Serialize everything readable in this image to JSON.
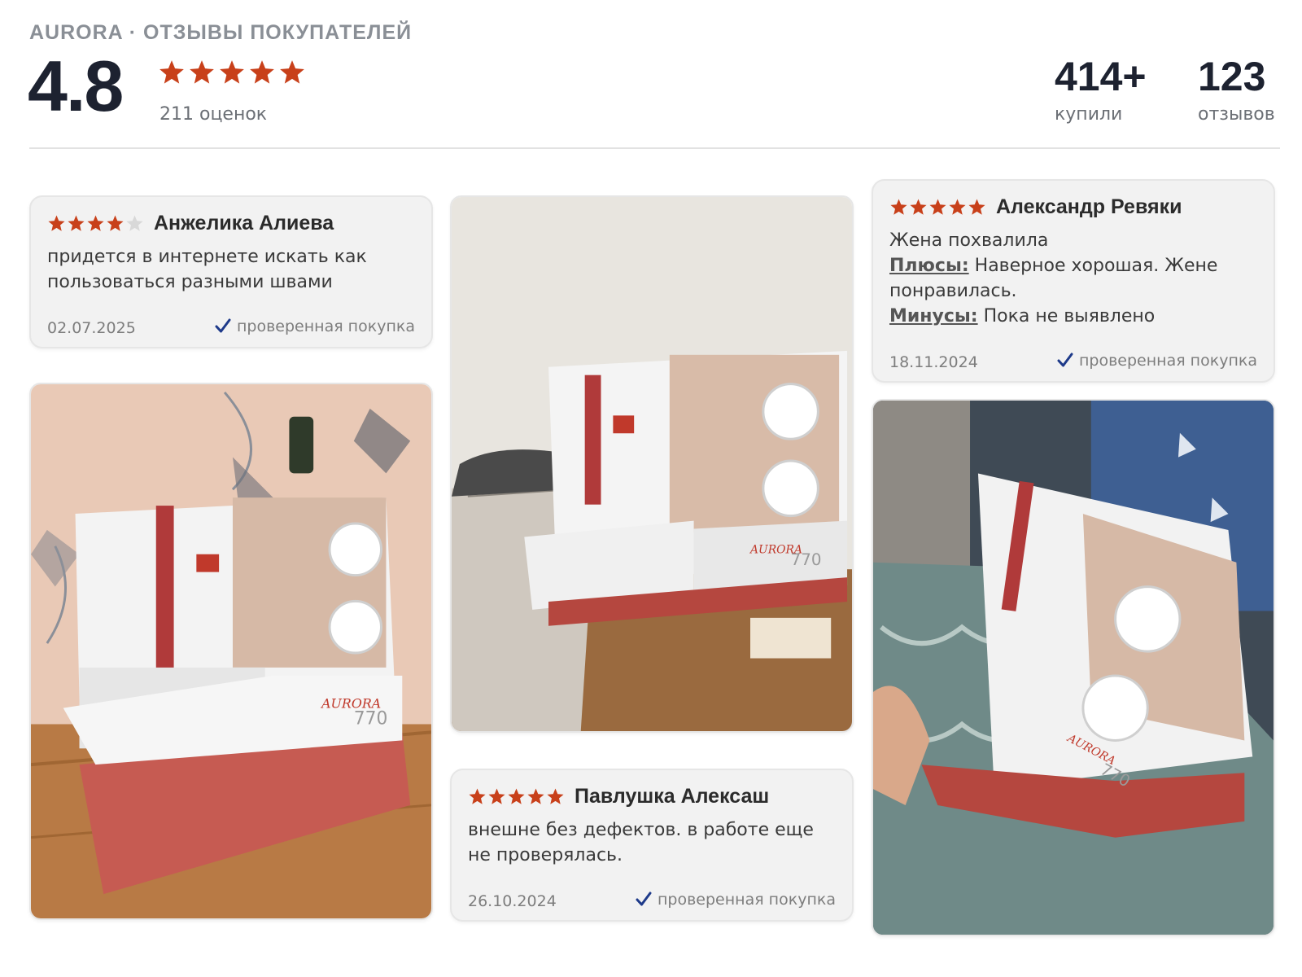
{
  "header": {
    "brand_line": "AURORA · ОТЗЫВЫ ПОКУПАТЕЛЕЙ",
    "rating": "4.8",
    "rating_stars": 5,
    "rating_count": "211 оценок",
    "bought_value": "414+",
    "bought_label": "купили",
    "reviews_value": "123",
    "reviews_label": "отзывов"
  },
  "colors": {
    "star": "#c8401a",
    "star_empty": "#d8d8d8",
    "check": "#1e3a8a",
    "card_bg": "#f2f2f2"
  },
  "icons": {
    "star": "star-icon",
    "check": "check-icon"
  },
  "reviews": [
    {
      "author": "Анжелика Алиева",
      "stars": 4,
      "text": "придется в интернете искать как пользоваться разными швами",
      "date": "02.07.2025",
      "verified": "проверенная покупка"
    },
    {
      "author": "Александр Ревяки",
      "stars": 5,
      "text": "Жена похвалила",
      "pros_label": "Плюсы:",
      "pros": "Наверное хорошая. Жене понравилась.",
      "cons_label": "Минусы:",
      "cons": "Пока не выявлено",
      "date": "18.11.2024",
      "verified": "проверенная покупка"
    },
    {
      "author": "Павлушка Алексаш",
      "stars": 5,
      "text": "внешне без дефектов. в работе еще не проверялась.",
      "date": "26.10.2024",
      "verified": "проверенная покупка"
    }
  ],
  "photos": {
    "machine_brand": "AURORA",
    "machine_model": "770"
  }
}
